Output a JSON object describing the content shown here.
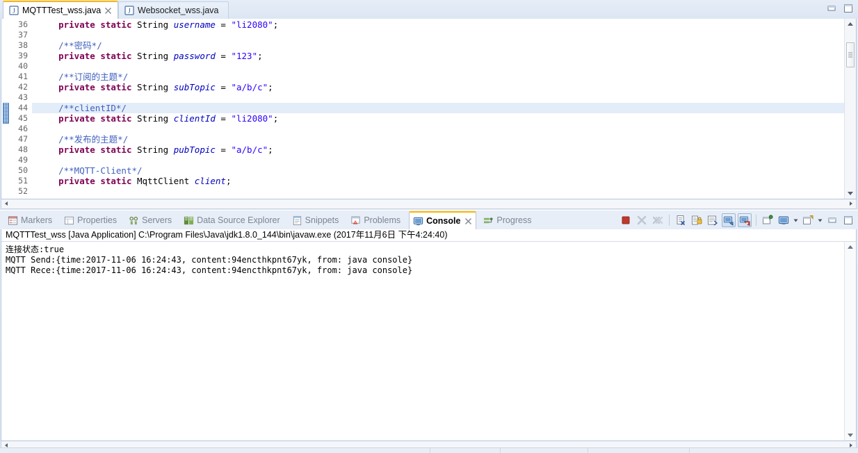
{
  "editor": {
    "tabs": [
      {
        "label": "MQTTTest_wss.java",
        "icon": "java-file-icon",
        "active": true,
        "closable": true
      },
      {
        "label": "Websocket_wss.java",
        "icon": "java-file-icon",
        "active": false,
        "closable": false
      }
    ],
    "window_buttons": [
      {
        "name": "minimize-button",
        "glyph": "minimize-icon"
      },
      {
        "name": "maximize-button",
        "glyph": "maximize-icon"
      }
    ],
    "first_line_number": 36,
    "highlight_line": 44,
    "changed_lines": [
      44,
      45
    ],
    "lines": [
      {
        "n": 36,
        "tokens": [
          {
            "t": "    ",
            "c": "pun"
          },
          {
            "t": "private static",
            "c": "kw"
          },
          {
            "t": " String ",
            "c": "typ"
          },
          {
            "t": "username",
            "c": "fld"
          },
          {
            "t": " = ",
            "c": "pun"
          },
          {
            "t": "\"li2080\"",
            "c": "str"
          },
          {
            "t": ";",
            "c": "pun"
          }
        ]
      },
      {
        "n": 37,
        "tokens": []
      },
      {
        "n": 38,
        "tokens": [
          {
            "t": "    ",
            "c": "pun"
          },
          {
            "t": "/**密码*/",
            "c": "cmt"
          }
        ]
      },
      {
        "n": 39,
        "tokens": [
          {
            "t": "    ",
            "c": "pun"
          },
          {
            "t": "private static",
            "c": "kw"
          },
          {
            "t": " String ",
            "c": "typ"
          },
          {
            "t": "password",
            "c": "fld"
          },
          {
            "t": " = ",
            "c": "pun"
          },
          {
            "t": "\"123\"",
            "c": "str"
          },
          {
            "t": ";",
            "c": "pun"
          }
        ]
      },
      {
        "n": 40,
        "tokens": []
      },
      {
        "n": 41,
        "tokens": [
          {
            "t": "    ",
            "c": "pun"
          },
          {
            "t": "/**订阅的主题*/",
            "c": "cmt"
          }
        ]
      },
      {
        "n": 42,
        "tokens": [
          {
            "t": "    ",
            "c": "pun"
          },
          {
            "t": "private static",
            "c": "kw"
          },
          {
            "t": " String ",
            "c": "typ"
          },
          {
            "t": "subTopic",
            "c": "fld"
          },
          {
            "t": " = ",
            "c": "pun"
          },
          {
            "t": "\"a/b/c\"",
            "c": "str"
          },
          {
            "t": ";",
            "c": "pun"
          }
        ]
      },
      {
        "n": 43,
        "tokens": []
      },
      {
        "n": 44,
        "tokens": [
          {
            "t": "    ",
            "c": "pun"
          },
          {
            "t": "/**clientID*/",
            "c": "cmt"
          }
        ]
      },
      {
        "n": 45,
        "tokens": [
          {
            "t": "    ",
            "c": "pun"
          },
          {
            "t": "private static",
            "c": "kw"
          },
          {
            "t": " String ",
            "c": "typ"
          },
          {
            "t": "clientId",
            "c": "fld"
          },
          {
            "t": " = ",
            "c": "pun"
          },
          {
            "t": "\"li2080\"",
            "c": "str"
          },
          {
            "t": ";",
            "c": "pun"
          }
        ]
      },
      {
        "n": 46,
        "tokens": []
      },
      {
        "n": 47,
        "tokens": [
          {
            "t": "    ",
            "c": "pun"
          },
          {
            "t": "/**发布的主题*/",
            "c": "cmt"
          }
        ]
      },
      {
        "n": 48,
        "tokens": [
          {
            "t": "    ",
            "c": "pun"
          },
          {
            "t": "private static",
            "c": "kw"
          },
          {
            "t": " String ",
            "c": "typ"
          },
          {
            "t": "pubTopic",
            "c": "fld"
          },
          {
            "t": " = ",
            "c": "pun"
          },
          {
            "t": "\"a/b/c\"",
            "c": "str"
          },
          {
            "t": ";",
            "c": "pun"
          }
        ]
      },
      {
        "n": 49,
        "tokens": []
      },
      {
        "n": 50,
        "tokens": [
          {
            "t": "    ",
            "c": "pun"
          },
          {
            "t": "/**MQTT-Client*/",
            "c": "cmt"
          }
        ]
      },
      {
        "n": 51,
        "tokens": [
          {
            "t": "    ",
            "c": "pun"
          },
          {
            "t": "private static",
            "c": "kw"
          },
          {
            "t": " MqttClient ",
            "c": "typ"
          },
          {
            "t": "client",
            "c": "fld"
          },
          {
            "t": ";",
            "c": "pun"
          }
        ]
      },
      {
        "n": 52,
        "tokens": []
      }
    ]
  },
  "console_view": {
    "tabs": [
      {
        "label": "Markers",
        "icon": "markers-icon",
        "active": false,
        "closable": false
      },
      {
        "label": "Properties",
        "icon": "properties-icon",
        "active": false,
        "closable": false
      },
      {
        "label": "Servers",
        "icon": "servers-icon",
        "active": false,
        "closable": false
      },
      {
        "label": "Data Source Explorer",
        "icon": "data-source-explorer-icon",
        "active": false,
        "closable": false
      },
      {
        "label": "Snippets",
        "icon": "snippets-icon",
        "active": false,
        "closable": false
      },
      {
        "label": "Problems",
        "icon": "problems-icon",
        "active": false,
        "closable": false
      },
      {
        "label": "Console",
        "icon": "console-icon",
        "active": true,
        "closable": true
      },
      {
        "label": "Progress",
        "icon": "progress-icon",
        "active": false,
        "closable": false
      }
    ],
    "toolbar": [
      {
        "name": "terminate-button",
        "icon": "stop-square-icon",
        "enabled": true,
        "toggled": false
      },
      {
        "name": "remove-launch-button",
        "icon": "remove-x-icon",
        "enabled": false,
        "toggled": false
      },
      {
        "name": "remove-all-terminated-button",
        "icon": "remove-all-x-icon",
        "enabled": false,
        "toggled": false
      },
      {
        "name": "separator-1",
        "icon": "separator",
        "enabled": false,
        "toggled": false
      },
      {
        "name": "clear-console-button",
        "icon": "clear-console-icon",
        "enabled": true,
        "toggled": false
      },
      {
        "name": "scroll-lock-button",
        "icon": "scroll-lock-icon",
        "enabled": true,
        "toggled": false
      },
      {
        "name": "word-wrap-button",
        "icon": "word-wrap-icon",
        "enabled": true,
        "toggled": false
      },
      {
        "name": "show-console-on-output-button",
        "icon": "show-on-stdout-icon",
        "enabled": true,
        "toggled": true
      },
      {
        "name": "show-console-on-error-button",
        "icon": "show-on-stderr-icon",
        "enabled": true,
        "toggled": true
      },
      {
        "name": "separator-2",
        "icon": "separator",
        "enabled": false,
        "toggled": false
      },
      {
        "name": "pin-console-button",
        "icon": "pin-console-icon",
        "enabled": true,
        "toggled": false
      },
      {
        "name": "display-selected-console-button",
        "icon": "display-console-icon",
        "enabled": true,
        "toggled": false
      },
      {
        "name": "display-selected-console-caret",
        "icon": "chevron-down-icon",
        "enabled": true,
        "toggled": false
      },
      {
        "name": "open-console-button",
        "icon": "new-console-icon",
        "enabled": true,
        "toggled": false
      },
      {
        "name": "open-console-caret",
        "icon": "chevron-down-icon",
        "enabled": true,
        "toggled": false
      },
      {
        "name": "minimize-view-button",
        "icon": "minimize-icon",
        "enabled": true,
        "toggled": false
      },
      {
        "name": "maximize-view-button",
        "icon": "maximize-icon",
        "enabled": true,
        "toggled": false
      }
    ],
    "header": "MQTTTest_wss [Java Application] C:\\Program Files\\Java\\jdk1.8.0_144\\bin\\javaw.exe (2017年11月6日 下午4:24:40)",
    "output_lines": [
      "连接状态:true",
      "MQTT Send:{time:2017-11-06 16:24:43, content:94encthkpnt67yk, from: java console}",
      "MQTT Rece:{time:2017-11-06 16:24:43, content:94encthkpnt67yk, from: java console}"
    ]
  },
  "colors": {
    "keyword": "#7f0055",
    "field": "#0000c0",
    "string": "#2a00ff",
    "comment": "#3f5fbf",
    "tab_accent": "#fdb600",
    "panel_bg": "#e4ebf6"
  }
}
